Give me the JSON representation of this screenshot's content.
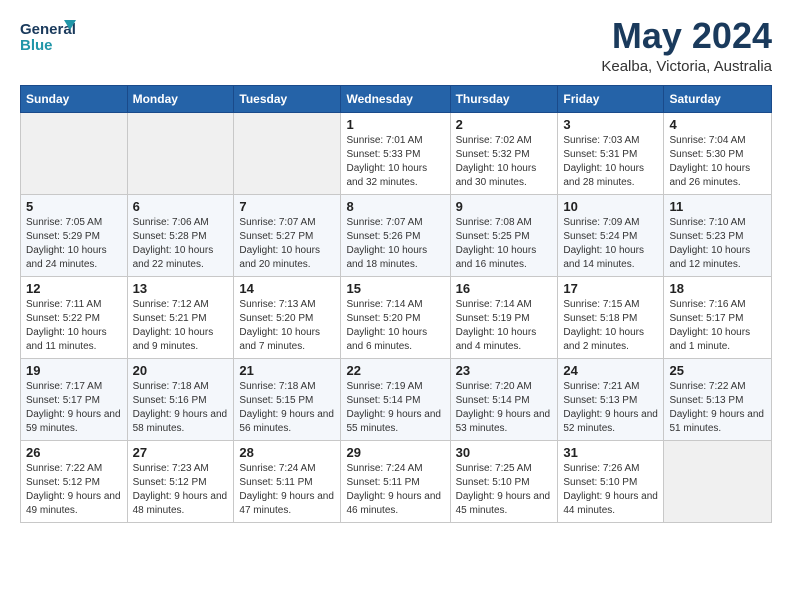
{
  "header": {
    "logo_line1": "General",
    "logo_line2": "Blue",
    "month_title": "May 2024",
    "location": "Kealba, Victoria, Australia"
  },
  "days_of_week": [
    "Sunday",
    "Monday",
    "Tuesday",
    "Wednesday",
    "Thursday",
    "Friday",
    "Saturday"
  ],
  "weeks": [
    [
      null,
      null,
      null,
      {
        "num": "1",
        "sunrise": "7:01 AM",
        "sunset": "5:33 PM",
        "daylight": "10 hours and 32 minutes."
      },
      {
        "num": "2",
        "sunrise": "7:02 AM",
        "sunset": "5:32 PM",
        "daylight": "10 hours and 30 minutes."
      },
      {
        "num": "3",
        "sunrise": "7:03 AM",
        "sunset": "5:31 PM",
        "daylight": "10 hours and 28 minutes."
      },
      {
        "num": "4",
        "sunrise": "7:04 AM",
        "sunset": "5:30 PM",
        "daylight": "10 hours and 26 minutes."
      }
    ],
    [
      {
        "num": "5",
        "sunrise": "7:05 AM",
        "sunset": "5:29 PM",
        "daylight": "10 hours and 24 minutes."
      },
      {
        "num": "6",
        "sunrise": "7:06 AM",
        "sunset": "5:28 PM",
        "daylight": "10 hours and 22 minutes."
      },
      {
        "num": "7",
        "sunrise": "7:07 AM",
        "sunset": "5:27 PM",
        "daylight": "10 hours and 20 minutes."
      },
      {
        "num": "8",
        "sunrise": "7:07 AM",
        "sunset": "5:26 PM",
        "daylight": "10 hours and 18 minutes."
      },
      {
        "num": "9",
        "sunrise": "7:08 AM",
        "sunset": "5:25 PM",
        "daylight": "10 hours and 16 minutes."
      },
      {
        "num": "10",
        "sunrise": "7:09 AM",
        "sunset": "5:24 PM",
        "daylight": "10 hours and 14 minutes."
      },
      {
        "num": "11",
        "sunrise": "7:10 AM",
        "sunset": "5:23 PM",
        "daylight": "10 hours and 12 minutes."
      }
    ],
    [
      {
        "num": "12",
        "sunrise": "7:11 AM",
        "sunset": "5:22 PM",
        "daylight": "10 hours and 11 minutes."
      },
      {
        "num": "13",
        "sunrise": "7:12 AM",
        "sunset": "5:21 PM",
        "daylight": "10 hours and 9 minutes."
      },
      {
        "num": "14",
        "sunrise": "7:13 AM",
        "sunset": "5:20 PM",
        "daylight": "10 hours and 7 minutes."
      },
      {
        "num": "15",
        "sunrise": "7:14 AM",
        "sunset": "5:20 PM",
        "daylight": "10 hours and 6 minutes."
      },
      {
        "num": "16",
        "sunrise": "7:14 AM",
        "sunset": "5:19 PM",
        "daylight": "10 hours and 4 minutes."
      },
      {
        "num": "17",
        "sunrise": "7:15 AM",
        "sunset": "5:18 PM",
        "daylight": "10 hours and 2 minutes."
      },
      {
        "num": "18",
        "sunrise": "7:16 AM",
        "sunset": "5:17 PM",
        "daylight": "10 hours and 1 minute."
      }
    ],
    [
      {
        "num": "19",
        "sunrise": "7:17 AM",
        "sunset": "5:17 PM",
        "daylight": "9 hours and 59 minutes."
      },
      {
        "num": "20",
        "sunrise": "7:18 AM",
        "sunset": "5:16 PM",
        "daylight": "9 hours and 58 minutes."
      },
      {
        "num": "21",
        "sunrise": "7:18 AM",
        "sunset": "5:15 PM",
        "daylight": "9 hours and 56 minutes."
      },
      {
        "num": "22",
        "sunrise": "7:19 AM",
        "sunset": "5:14 PM",
        "daylight": "9 hours and 55 minutes."
      },
      {
        "num": "23",
        "sunrise": "7:20 AM",
        "sunset": "5:14 PM",
        "daylight": "9 hours and 53 minutes."
      },
      {
        "num": "24",
        "sunrise": "7:21 AM",
        "sunset": "5:13 PM",
        "daylight": "9 hours and 52 minutes."
      },
      {
        "num": "25",
        "sunrise": "7:22 AM",
        "sunset": "5:13 PM",
        "daylight": "9 hours and 51 minutes."
      }
    ],
    [
      {
        "num": "26",
        "sunrise": "7:22 AM",
        "sunset": "5:12 PM",
        "daylight": "9 hours and 49 minutes."
      },
      {
        "num": "27",
        "sunrise": "7:23 AM",
        "sunset": "5:12 PM",
        "daylight": "9 hours and 48 minutes."
      },
      {
        "num": "28",
        "sunrise": "7:24 AM",
        "sunset": "5:11 PM",
        "daylight": "9 hours and 47 minutes."
      },
      {
        "num": "29",
        "sunrise": "7:24 AM",
        "sunset": "5:11 PM",
        "daylight": "9 hours and 46 minutes."
      },
      {
        "num": "30",
        "sunrise": "7:25 AM",
        "sunset": "5:10 PM",
        "daylight": "9 hours and 45 minutes."
      },
      {
        "num": "31",
        "sunrise": "7:26 AM",
        "sunset": "5:10 PM",
        "daylight": "9 hours and 44 minutes."
      },
      null
    ]
  ],
  "labels": {
    "sunrise": "Sunrise:",
    "sunset": "Sunset:",
    "daylight": "Daylight hours"
  }
}
